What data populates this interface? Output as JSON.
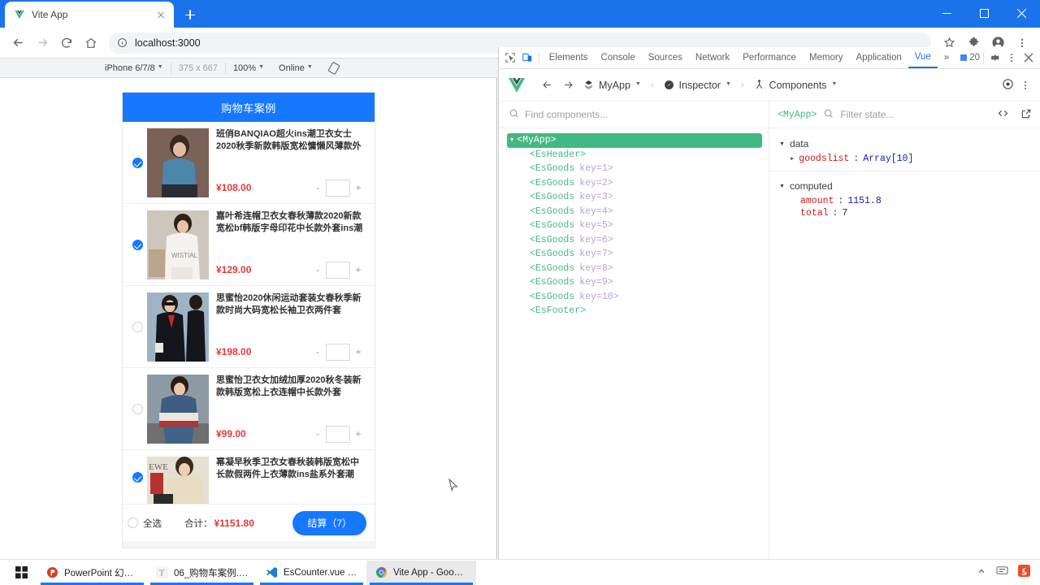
{
  "browser": {
    "tab": {
      "title": "Vite App",
      "favicon": "vue-logo-icon",
      "close": "close-icon"
    },
    "new_tab": "+",
    "window_controls": {
      "minimize": "minimize-icon",
      "maximize": "maximize-icon",
      "close": "close-icon"
    },
    "nav": {
      "back": "back-arrow-icon",
      "forward": "forward-arrow-icon",
      "reload": "reload-icon",
      "home": "home-icon",
      "url": "localhost:3000",
      "site_info": "info-circle-icon",
      "bookmark": "star-icon",
      "extensions": "puzzle-icon",
      "profile": "avatar-icon",
      "menu": "three-dots-icon"
    }
  },
  "device_toolbar": {
    "device": "iPhone 6/7/8",
    "width": "375",
    "times": "x",
    "height": "667",
    "zoom": "100%",
    "throttling": "Online",
    "rotate": "rotate-icon",
    "more": "three-dots-icon"
  },
  "app": {
    "header_title": "购物车案例",
    "items": [
      {
        "title": "班俏BANQIAO超火ins潮卫衣女士2020秋季新款韩版宽松慵懒风薄款外套带帽上衣",
        "price": "¥108.00",
        "qty": "",
        "checked": true,
        "minus": "-",
        "plus": "+"
      },
      {
        "title": "嘉叶希连帽卫衣女春秋薄款2020新款宽松bf韩版字母印花中长款外套ins潮",
        "price": "¥129.00",
        "qty": "",
        "checked": true,
        "minus": "-",
        "plus": "+"
      },
      {
        "title": "思蜜怡2020休闲运动套装女春秋季新款时尚大码宽松长袖卫衣两件套",
        "price": "¥198.00",
        "qty": "",
        "checked": false,
        "minus": "-",
        "plus": "+"
      },
      {
        "title": "思蜜怡卫衣女加绒加厚2020秋冬装新款韩版宽松上衣连帽中长款外套",
        "price": "¥99.00",
        "qty": "",
        "checked": false,
        "minus": "-",
        "plus": "+"
      },
      {
        "title": "幂凝早秋季卫衣女春秋装韩版宽松中长款假两件上衣薄款ins盐系外套潮",
        "price": "",
        "qty": "",
        "checked": true,
        "minus": "-",
        "plus": "+"
      }
    ],
    "footer": {
      "select_all": "全选",
      "total_label": "合计：",
      "total_amount": "¥1151.80",
      "pay_button": "结算（7）"
    }
  },
  "devtools": {
    "left_icons": {
      "inspect": "inspect-element-icon",
      "device": "device-toggle-icon"
    },
    "tabs": [
      {
        "label": "Elements",
        "active": false
      },
      {
        "label": "Console",
        "active": false
      },
      {
        "label": "Sources",
        "active": false
      },
      {
        "label": "Network",
        "active": false
      },
      {
        "label": "Performance",
        "active": false
      },
      {
        "label": "Memory",
        "active": false
      },
      {
        "label": "Application",
        "active": false
      },
      {
        "label": "Vue",
        "active": true
      }
    ],
    "overflow": "»",
    "issue_count": "20",
    "settings": "gear-icon",
    "more": "three-dots-icon",
    "close": "close-icon",
    "vue_bar": {
      "logo": "vue-logo-icon",
      "back": "back-arrow-icon",
      "forward": "forward-arrow-icon",
      "app_name": "MyApp",
      "inspector": "Inspector",
      "components": "Components",
      "target": "target-icon",
      "more": "three-dots-icon",
      "sep": "›"
    },
    "components_pane": {
      "search_placeholder": "Find components...",
      "search_icon": "search-icon",
      "root": "<MyApp>",
      "nodes": [
        {
          "tag": "<EsHeader>",
          "key": ""
        },
        {
          "tag": "<EsGoods",
          "key": "key=1>"
        },
        {
          "tag": "<EsGoods",
          "key": "key=2>"
        },
        {
          "tag": "<EsGoods",
          "key": "key=3>"
        },
        {
          "tag": "<EsGoods",
          "key": "key=4>"
        },
        {
          "tag": "<EsGoods",
          "key": "key=5>"
        },
        {
          "tag": "<EsGoods",
          "key": "key=6>"
        },
        {
          "tag": "<EsGoods",
          "key": "key=7>"
        },
        {
          "tag": "<EsGoods",
          "key": "key=8>"
        },
        {
          "tag": "<EsGoods",
          "key": "key=9>"
        },
        {
          "tag": "<EsGoods",
          "key": "key=10>"
        },
        {
          "tag": "<EsFooter>",
          "key": ""
        }
      ]
    },
    "state_pane": {
      "selected": "<MyApp>",
      "filter_placeholder": "Filter state...",
      "search_icon": "search-icon",
      "code_icon": "code-brackets-icon",
      "open_icon": "open-external-icon",
      "groups": [
        {
          "name": "data",
          "rows": [
            {
              "key": "goodslist",
              "value": "Array[10]",
              "expandable": true
            }
          ]
        },
        {
          "name": "computed",
          "rows": [
            {
              "key": "amount",
              "value": "1151.8",
              "expandable": false
            },
            {
              "key": "total",
              "value": "7",
              "expandable": false
            }
          ]
        }
      ]
    }
  },
  "taskbar": {
    "start": "windows-logo-icon",
    "items": [
      {
        "label": "PowerPoint 幻灯...",
        "icon": "powerpoint-icon"
      },
      {
        "label": "06_购物车案例.md...",
        "icon": "typora-icon"
      },
      {
        "label": "EsCounter.vue - c...",
        "icon": "vscode-icon"
      },
      {
        "label": "Vite App - Googl...",
        "icon": "chrome-icon"
      }
    ],
    "tray": {
      "chevron": "chevron-up-icon",
      "ime": "ime-icon",
      "sogou": "sogou-icon"
    }
  },
  "colors": {
    "accent_blue": "#1678ff",
    "chrome_blue": "#1a73e8",
    "price_red": "#e4393c",
    "vue_green": "#42b883"
  }
}
